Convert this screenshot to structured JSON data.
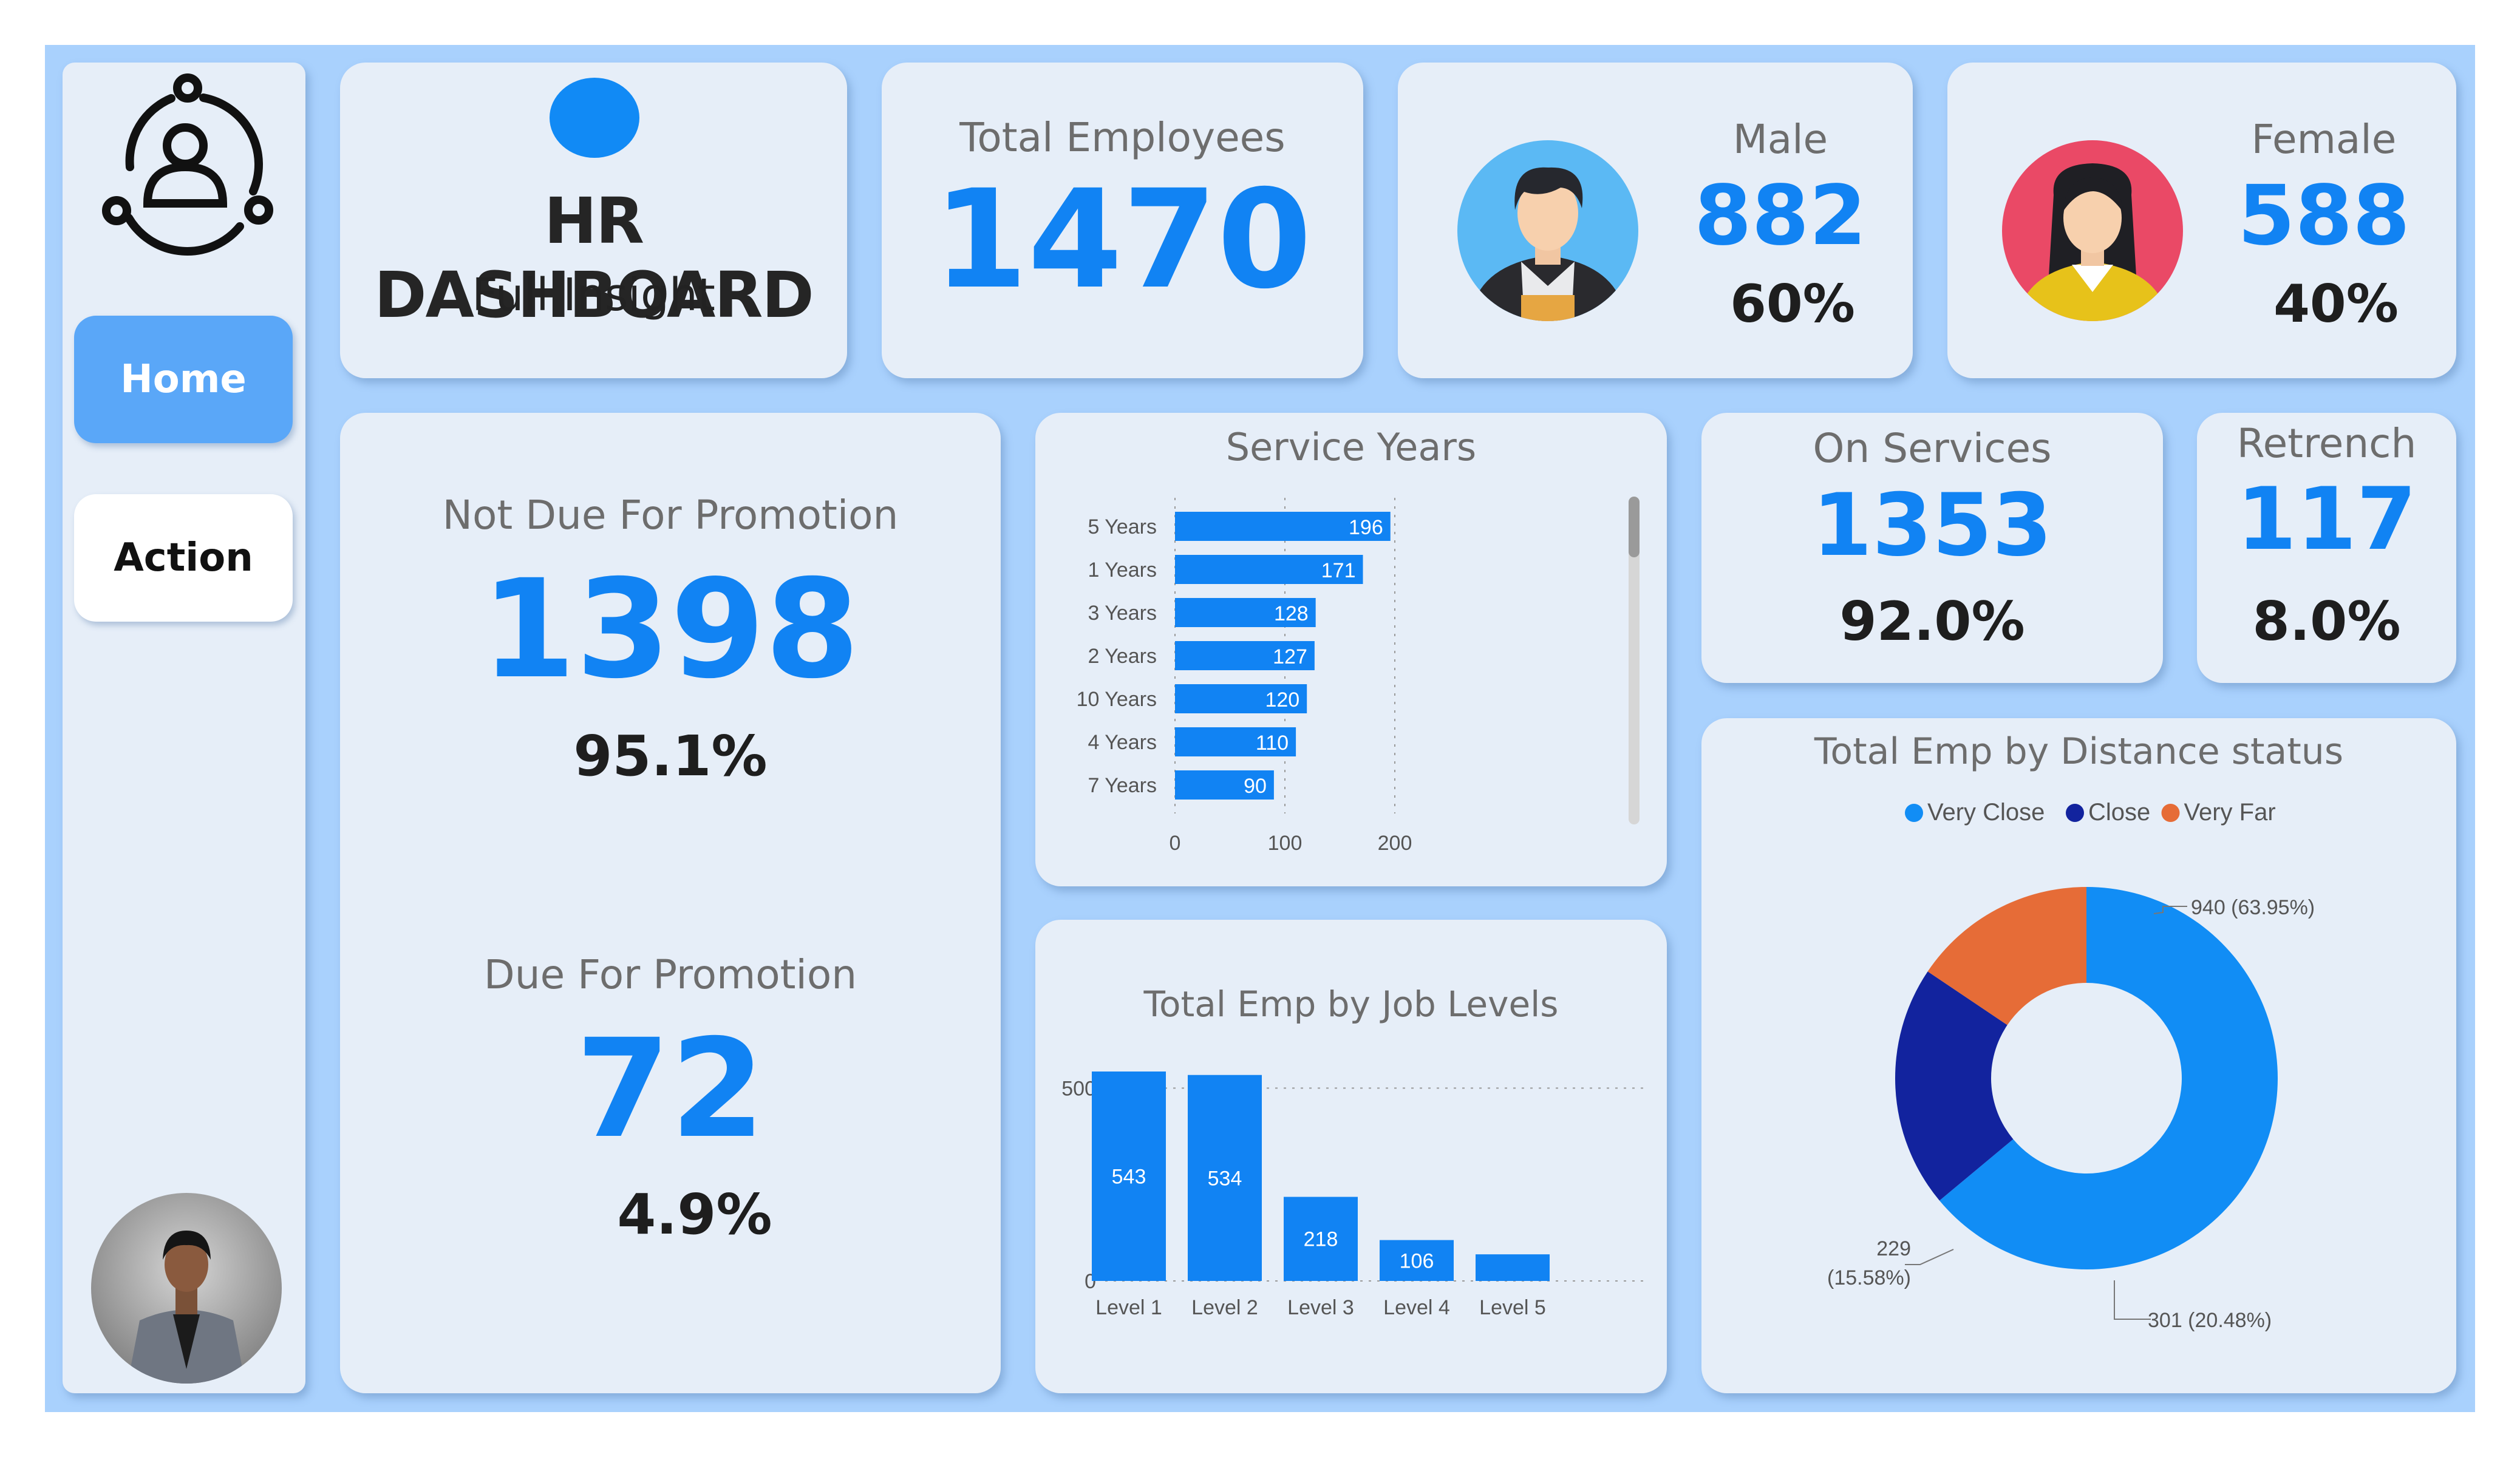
{
  "sidebar": {
    "nav": [
      {
        "label": "Home",
        "active": true
      },
      {
        "label": "Action",
        "active": false
      }
    ]
  },
  "header": {
    "title": "HR DASHBOARD",
    "subtitle": "Full Insight"
  },
  "kpis": {
    "total_employees": {
      "title": "Total Employees",
      "value": "1470"
    },
    "male": {
      "title": "Male",
      "value": "882",
      "percent": "60%"
    },
    "female": {
      "title": "Female",
      "value": "588",
      "percent": "40%"
    },
    "on_services": {
      "title": "On Services",
      "value": "1353",
      "percent": "92.0%"
    },
    "retrench": {
      "title": "Retrench",
      "value": "117",
      "percent": "8.0%"
    },
    "not_due": {
      "title": "Not Due For Promotion",
      "value": "1398",
      "percent": "95.1%"
    },
    "due": {
      "title": "Due For Promotion",
      "value": "72",
      "percent": "4.9%"
    }
  },
  "colors": {
    "accent": "#1183f3",
    "very_close": "#118df5",
    "close": "#12239e",
    "very_far": "#e66c37"
  },
  "chart_data": [
    {
      "type": "bar",
      "orientation": "horizontal",
      "title": "Service Years",
      "categories": [
        "5 Years",
        "1 Years",
        "3 Years",
        "2 Years",
        "10 Years",
        "4 Years",
        "7 Years"
      ],
      "values": [
        196,
        171,
        128,
        127,
        120,
        110,
        90
      ],
      "xlim": [
        0,
        200
      ],
      "ticks": [
        "0",
        "100",
        "200"
      ],
      "grid": true
    },
    {
      "type": "bar",
      "title": "Total Emp by Job Levels",
      "categories": [
        "Level 1",
        "Level 2",
        "Level 3",
        "Level 4",
        "Level 5"
      ],
      "values": [
        543,
        534,
        218,
        106,
        69
      ],
      "labels": [
        "543",
        "534",
        "218",
        "106",
        ""
      ],
      "ylim": [
        0,
        543
      ],
      "ticks": [
        "0",
        "500"
      ],
      "grid": true
    },
    {
      "type": "pie",
      "title": "Total Emp by Distance status",
      "legend_position": "top",
      "series": [
        {
          "name": "Very Close",
          "value": 940,
          "label": "940 (63.95%)"
        },
        {
          "name": "Close",
          "value": 301,
          "label": "301 (20.48%)"
        },
        {
          "name": "Very Far",
          "value": 229,
          "label_line1": "229",
          "label_line2": "(15.58%)"
        }
      ]
    }
  ]
}
